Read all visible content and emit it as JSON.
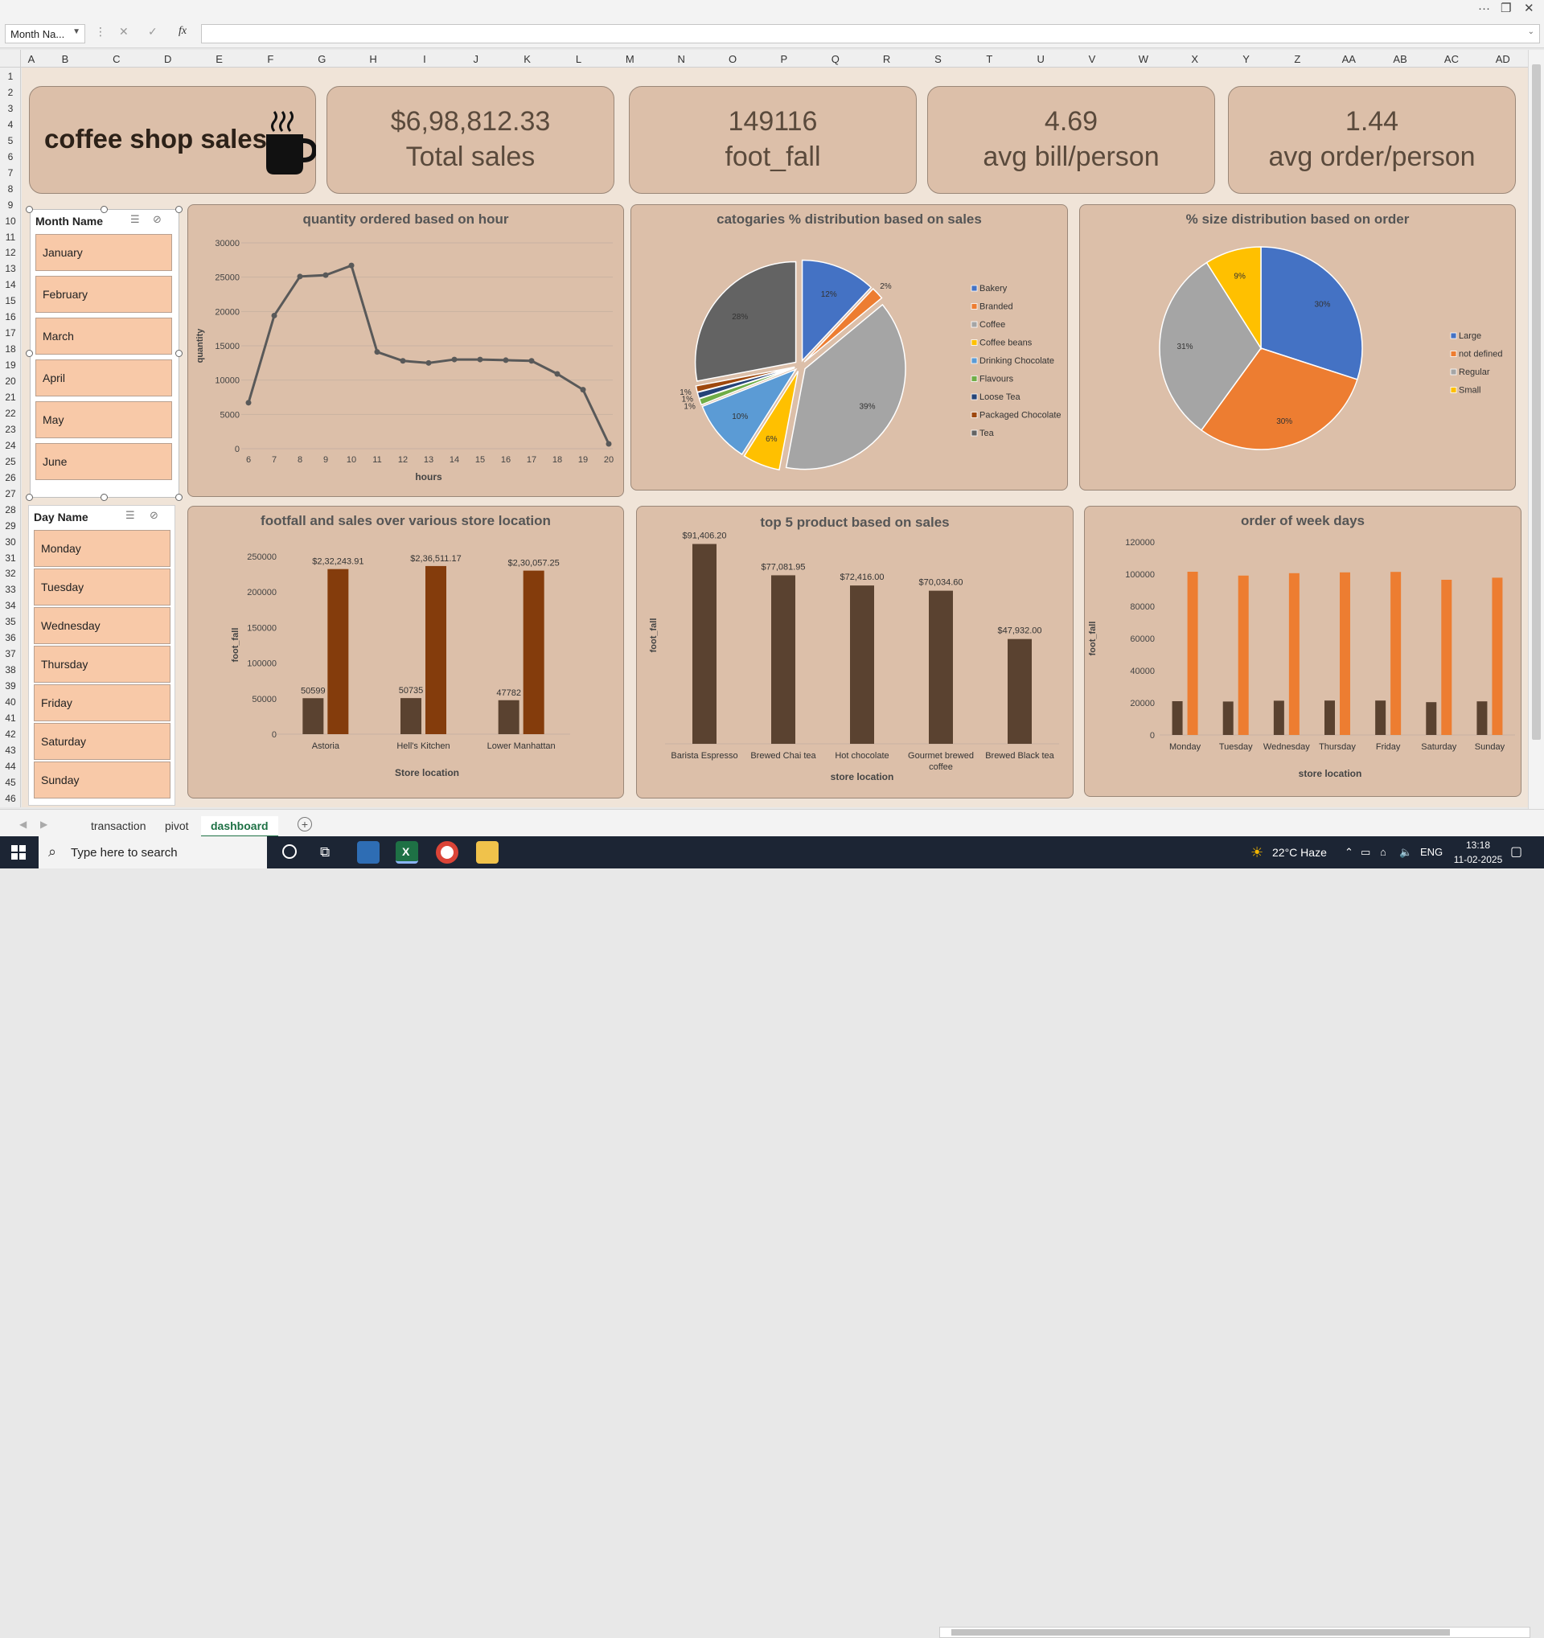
{
  "formula_bar": {
    "name_box": "Month Na...",
    "fx": "fx"
  },
  "columns": [
    "A",
    "B",
    "C",
    "D",
    "E",
    "F",
    "G",
    "H",
    "I",
    "J",
    "K",
    "L",
    "M",
    "N",
    "O",
    "P",
    "Q",
    "R",
    "S",
    "T",
    "U",
    "V",
    "W",
    "X",
    "Y",
    "Z",
    "AA",
    "AB",
    "AC",
    "AD"
  ],
  "rows": [
    "1",
    "2",
    "3",
    "4",
    "5",
    "6",
    "7",
    "8",
    "9",
    "10",
    "11",
    "12",
    "13",
    "14",
    "15",
    "16",
    "17",
    "18",
    "19",
    "20",
    "21",
    "22",
    "23",
    "24",
    "25",
    "26",
    "27",
    "28",
    "29",
    "30",
    "31",
    "32",
    "33",
    "34",
    "35",
    "36",
    "37",
    "38",
    "39",
    "40",
    "41",
    "42",
    "43",
    "44",
    "45",
    "46"
  ],
  "header": {
    "title": "coffee shop sales"
  },
  "kpis": [
    {
      "value": "$6,98,812.33",
      "label": "Total sales"
    },
    {
      "value": "149116",
      "label": "foot_fall"
    },
    {
      "value": "4.69",
      "label": "avg bill/person"
    },
    {
      "value": "1.44",
      "label": "avg order/person"
    }
  ],
  "month_slicer": {
    "title": "Month Name",
    "items": [
      "January",
      "February",
      "March",
      "April",
      "May",
      "June"
    ]
  },
  "day_slicer": {
    "title": "Day Name",
    "items": [
      "Monday",
      "Tuesday",
      "Wednesday",
      "Thursday",
      "Friday",
      "Saturday",
      "Sunday"
    ]
  },
  "colors": {
    "dark_brown": "#5a4230",
    "rust": "#843c0c",
    "orange": "#ed7d31",
    "line": "#595959",
    "panel": "#dcbfa9",
    "card_text": "#5a4a3c",
    "slicer_item": "#f8c9a8",
    "excel_green": "#1e7145"
  },
  "chart_data": [
    {
      "type": "line",
      "title": "quantity ordered based on hour",
      "xlabel": "hours",
      "ylabel": "quantity",
      "x": [
        6,
        7,
        8,
        9,
        10,
        11,
        12,
        13,
        14,
        15,
        16,
        17,
        18,
        19,
        20
      ],
      "y": [
        6700,
        19400,
        25100,
        25300,
        26700,
        14100,
        12800,
        12500,
        13000,
        13000,
        12900,
        12800,
        10900,
        8600,
        700
      ],
      "ylim": [
        0,
        30000
      ],
      "yticks": [
        "0",
        "5000",
        "10000",
        "15000",
        "20000",
        "25000",
        "30000"
      ],
      "grid": true
    },
    {
      "type": "pie",
      "title": "catogaries % distribution based on sales",
      "categories": [
        "Bakery",
        "Branded",
        "Coffee",
        "Coffee beans",
        "Drinking Chocolate",
        "Flavours",
        "Loose Tea",
        "Packaged Chocolate",
        "Tea"
      ],
      "values": [
        12,
        2,
        39,
        6,
        10,
        1,
        1,
        1,
        28
      ],
      "labels": [
        "12%",
        "2%",
        "39%",
        "6%",
        "10%",
        "1%",
        "1%",
        "1%",
        "28%"
      ],
      "colors": [
        "#4472c4",
        "#ed7d31",
        "#a5a5a5",
        "#ffc000",
        "#5b9bd5",
        "#70ad47",
        "#264478",
        "#9e480e",
        "#636363"
      ],
      "legend": "right"
    },
    {
      "type": "pie",
      "title": "% size distribution based on order",
      "categories": [
        "Large",
        "not defined",
        "Regular",
        "Small"
      ],
      "values": [
        30,
        30,
        31,
        9
      ],
      "labels": [
        "30%",
        "30%",
        "31%",
        "9%"
      ],
      "colors": [
        "#4472c4",
        "#ed7d31",
        "#a5a5a5",
        "#ffc000"
      ],
      "legend": "right"
    },
    {
      "type": "bar",
      "title": "footfall and sales over various store location",
      "xlabel": "Store location",
      "ylabel": "foot_fall",
      "categories": [
        "Astoria",
        "Hell's Kitchen",
        "Lower Manhattan"
      ],
      "series": [
        {
          "values": [
            50599,
            50735,
            47782
          ],
          "labels": [
            "50599",
            "50735",
            "47782"
          ]
        },
        {
          "values": [
            232243.91,
            236511.17,
            230057.25
          ],
          "labels": [
            "$2,32,243.91",
            "$2,36,511.17",
            "$2,30,057.25"
          ]
        }
      ],
      "ylim": [
        0,
        250000
      ],
      "yticks": [
        "0",
        "50000",
        "100000",
        "150000",
        "200000",
        "250000"
      ]
    },
    {
      "type": "bar",
      "title": "top 5 product based on sales",
      "xlabel": "store location",
      "ylabel": "foot_fall",
      "categories": [
        "Barista Espresso",
        "Brewed Chai tea",
        "Hot chocolate",
        "Gourmet brewed coffee",
        "Brewed Black tea"
      ],
      "values": [
        91406.2,
        77081.95,
        72416.0,
        70034.6,
        47932.0
      ],
      "labels": [
        "$91,406.20",
        "$77,081.95",
        "$72,416.00",
        "$70,034.60",
        "$47,932.00"
      ]
    },
    {
      "type": "bar",
      "title": "order of week days",
      "xlabel": "store location",
      "ylabel": "foot_fall",
      "categories": [
        "Monday",
        "Tuesday",
        "Wednesday",
        "Thursday",
        "Friday",
        "Saturday",
        "Sunday"
      ],
      "series": [
        {
          "values": [
            21000,
            20800,
            21300,
            21400,
            21400,
            20400,
            20900
          ]
        },
        {
          "values": [
            101500,
            99100,
            100600,
            101100,
            101400,
            96500,
            97800
          ]
        }
      ],
      "ylim": [
        0,
        120000
      ],
      "yticks": [
        "0",
        "20000",
        "40000",
        "60000",
        "80000",
        "100000",
        "120000"
      ]
    }
  ],
  "sheet_tabs": [
    "transaction",
    "pivot",
    "dashboard"
  ],
  "taskbar": {
    "search_placeholder": "Type here to search",
    "weather": "22°C  Haze",
    "lang": "ENG",
    "time": "13:18",
    "date": "11-02-2025"
  }
}
